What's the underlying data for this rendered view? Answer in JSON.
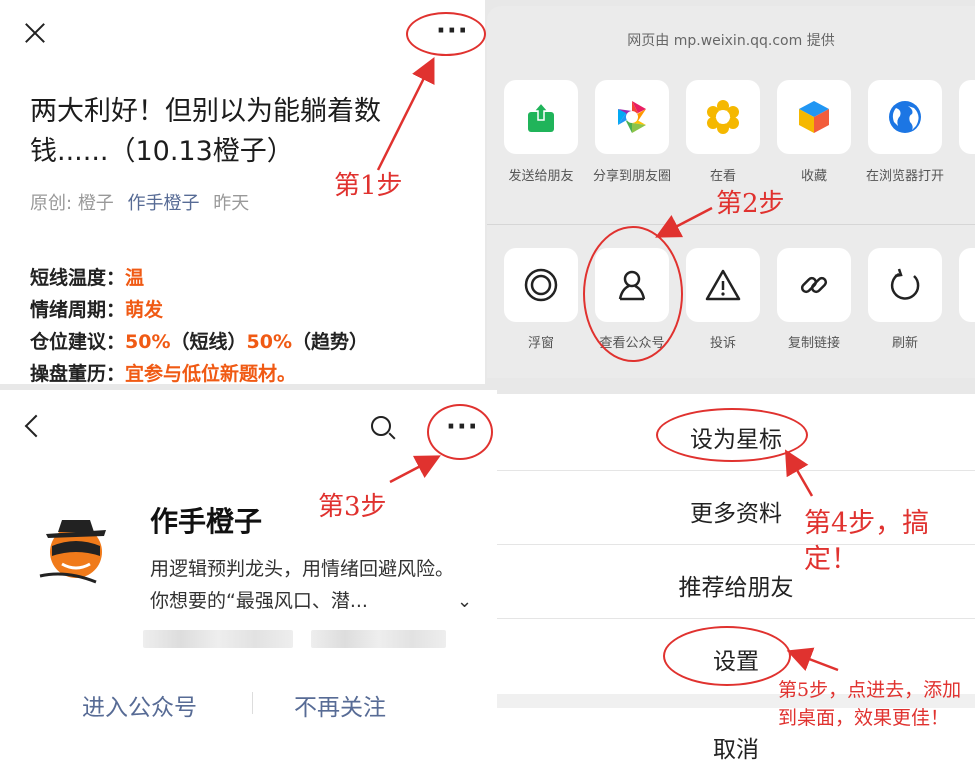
{
  "article": {
    "title": "两大利好！但别以为能躺着数钱......（10.13橙子）",
    "meta_original": "原创:",
    "meta_author": "橙子",
    "meta_account": "作手橙子",
    "meta_time": "昨天",
    "lines": [
      {
        "label": "短线温度：",
        "value": "温"
      },
      {
        "label": "情绪周期：",
        "value": "萌发"
      },
      {
        "label": "仓位建议：",
        "value_parts": [
          "50%",
          "（短线）",
          "50%",
          "（趋势）"
        ]
      },
      {
        "label": "操盘董历：",
        "value": "宜参与低位新题材。"
      }
    ]
  },
  "share_sheet": {
    "provider": "网页由 mp.weixin.qq.com 提供",
    "row1": [
      {
        "label": "发送给朋友",
        "icon": "share-arrow-icon",
        "color": "#20b45a"
      },
      {
        "label": "分享到朋友圈",
        "icon": "moments-icon",
        "color": "#ff8a00"
      },
      {
        "label": "在看",
        "icon": "star-flower-icon",
        "color": "#f5b800"
      },
      {
        "label": "收藏",
        "icon": "cube-icon",
        "color": "#f25d3c"
      },
      {
        "label": "在浏览器打开",
        "icon": "globe-icon",
        "color": "#1c76e4"
      }
    ],
    "row2": [
      {
        "label": "浮窗",
        "icon": "float-window-icon"
      },
      {
        "label": "查看公众号",
        "icon": "person-icon"
      },
      {
        "label": "投诉",
        "icon": "warning-icon"
      },
      {
        "label": "复制链接",
        "icon": "link-icon"
      },
      {
        "label": "刷新",
        "icon": "refresh-icon"
      }
    ]
  },
  "profile": {
    "name": "作手橙子",
    "description": "用逻辑预判龙头，用情绪回避风险。你想要的“最强风口、潜...",
    "enter_button": "进入公众号",
    "unfollow_button": "不再关注"
  },
  "menu": {
    "items": [
      "设为星标",
      "更多资料",
      "推荐给朋友",
      "设置"
    ],
    "cancel": "取消"
  },
  "annotations": {
    "step1": "第1步",
    "step2": "第2步",
    "step3": "第3步",
    "step4": "第4步，搞定！",
    "step5": "第5步，点进去，添加到桌面，效果更佳！",
    "color": "#e0322f"
  }
}
